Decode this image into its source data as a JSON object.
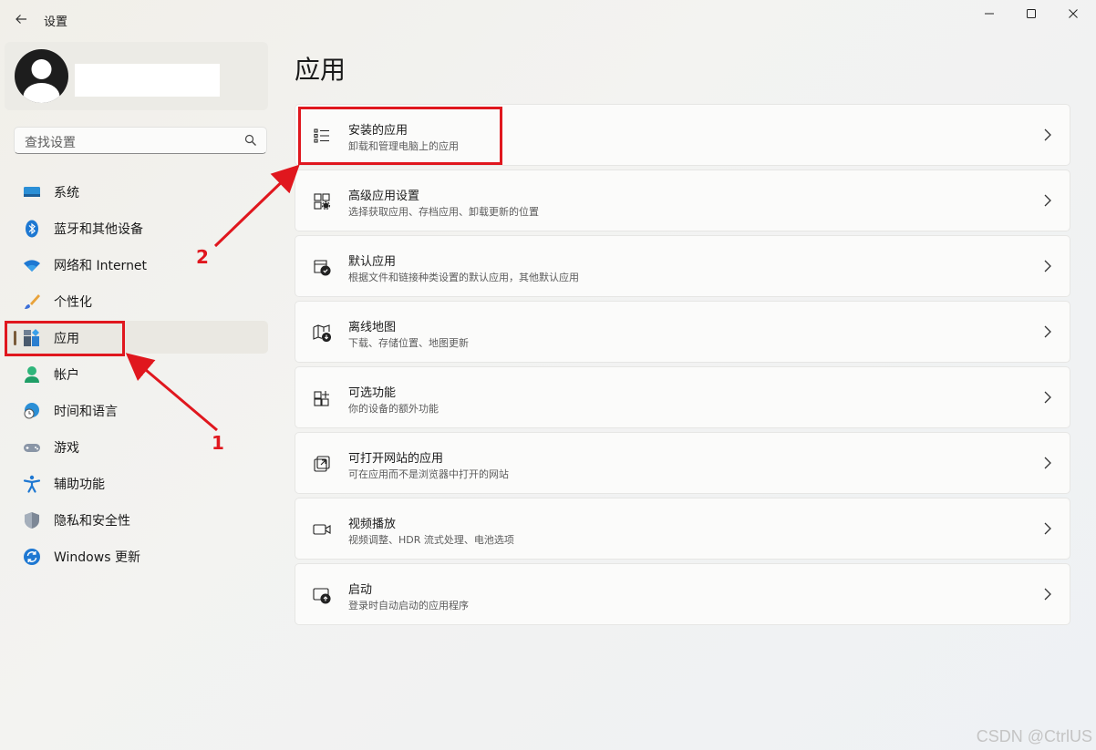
{
  "window": {
    "title": "设置"
  },
  "sidebar": {
    "search_placeholder": "查找设置",
    "items": [
      {
        "label": "系统",
        "icon": "monitor-icon"
      },
      {
        "label": "蓝牙和其他设备",
        "icon": "bluetooth-icon"
      },
      {
        "label": "网络和 Internet",
        "icon": "wifi-icon"
      },
      {
        "label": "个性化",
        "icon": "brush-icon"
      },
      {
        "label": "应用",
        "icon": "apps-icon",
        "selected": true
      },
      {
        "label": "帐户",
        "icon": "account-icon"
      },
      {
        "label": "时间和语言",
        "icon": "time-language-icon"
      },
      {
        "label": "游戏",
        "icon": "gamepad-icon"
      },
      {
        "label": "辅助功能",
        "icon": "accessibility-icon"
      },
      {
        "label": "隐私和安全性",
        "icon": "shield-icon"
      },
      {
        "label": "Windows 更新",
        "icon": "update-icon"
      }
    ]
  },
  "main": {
    "title": "应用",
    "cards": [
      {
        "title": "安装的应用",
        "subtitle": "卸载和管理电脑上的应用",
        "icon": "list-icon"
      },
      {
        "title": "高级应用设置",
        "subtitle": "选择获取应用、存档应用、卸载更新的位置",
        "icon": "app-settings-icon"
      },
      {
        "title": "默认应用",
        "subtitle": "根据文件和链接种类设置的默认应用，其他默认应用",
        "icon": "default-apps-icon"
      },
      {
        "title": "离线地图",
        "subtitle": "下载、存储位置、地图更新",
        "icon": "map-icon"
      },
      {
        "title": "可选功能",
        "subtitle": "你的设备的额外功能",
        "icon": "add-feature-icon"
      },
      {
        "title": "可打开网站的应用",
        "subtitle": "可在应用而不是浏览器中打开的网站",
        "icon": "open-web-icon"
      },
      {
        "title": "视频播放",
        "subtitle": "视频调整、HDR 流式处理、电池选项",
        "icon": "video-icon"
      },
      {
        "title": "启动",
        "subtitle": "登录时自动启动的应用程序",
        "icon": "startup-icon"
      }
    ]
  },
  "annotations": {
    "label_1": "1",
    "label_2": "2",
    "color": "#e0171e"
  },
  "watermark": "CSDN @CtrlUS"
}
